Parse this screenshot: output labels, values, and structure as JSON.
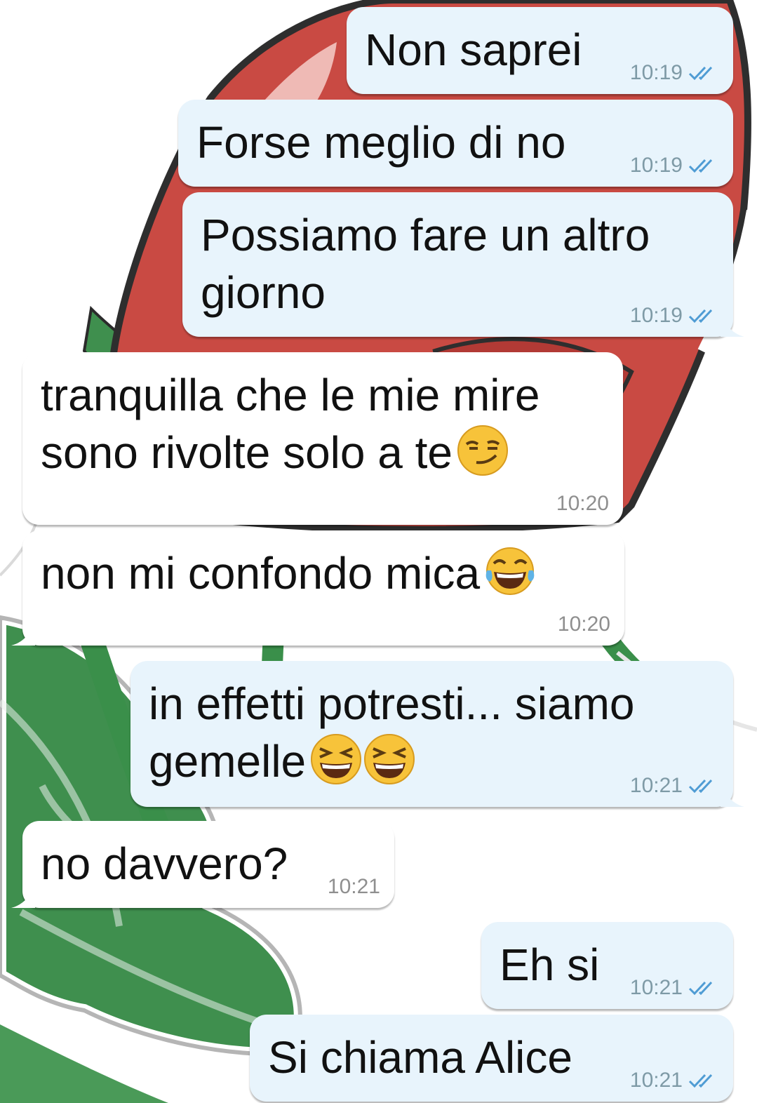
{
  "messages": [
    {
      "text": "Non saprei",
      "time": "10:19"
    },
    {
      "text": "Forse meglio di no",
      "time": "10:19"
    },
    {
      "text": "Possiamo fare un altro giorno",
      "time": "10:19"
    },
    {
      "text": "tranquilla che le mie mire sono rivolte solo a te",
      "time": "10:20"
    },
    {
      "text": "non mi confondo mica",
      "time": "10:20"
    },
    {
      "text": "in effetti potresti... siamo gemelle",
      "time": "10:21"
    },
    {
      "text": "no davvero?",
      "time": "10:21"
    },
    {
      "text": "Eh si",
      "time": "10:21"
    },
    {
      "text": "Si chiama Alice",
      "time": "10:21"
    }
  ],
  "icons": {
    "read_receipt": "double-check-icon",
    "emoji_smirk": "smirking-face-emoji",
    "emoji_laugh": "tears-of-joy-emoji",
    "emoji_grin": "grinning-squinting-face-emoji"
  },
  "colors": {
    "outgoing_bubble": "#e8f4fc",
    "incoming_bubble": "#ffffff",
    "read_tick": "#4f9cd4"
  }
}
